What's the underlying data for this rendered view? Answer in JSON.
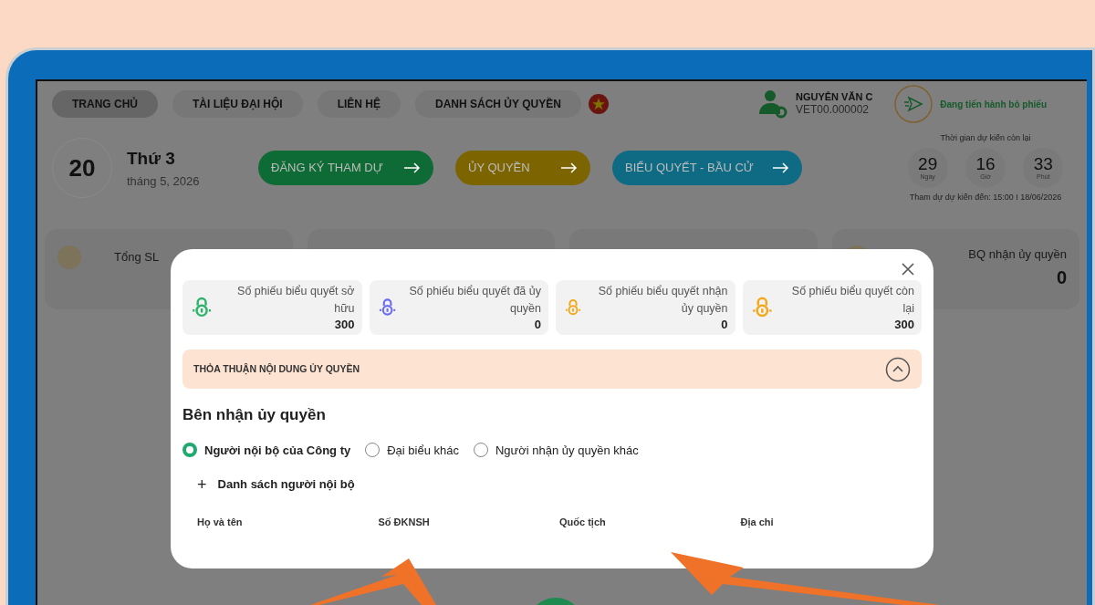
{
  "nav": {
    "items": [
      {
        "label": "TRANG CHỦ",
        "selected": true
      },
      {
        "label": "TÀI LIỆU ĐẠI HỘI",
        "selected": false
      },
      {
        "label": "LIÊN HỆ",
        "selected": false
      },
      {
        "label": "DANH SÁCH ỦY QUYỀN",
        "selected": false
      }
    ]
  },
  "user": {
    "name": "NGUYỄN VĂN C",
    "code": "VET00.000002"
  },
  "status": "Đang tiến hành bỏ phiếu",
  "date": {
    "day": "20",
    "weekday": "Thứ 3",
    "month_year": "tháng 5, 2026"
  },
  "actions": [
    {
      "label": "ĐĂNG KÝ THAM DỰ",
      "color": "#0f6b35"
    },
    {
      "label": "ỦY QUYỀN",
      "color": "#7c6400"
    },
    {
      "label": "BIỂU QUYẾT - BẦU CỬ",
      "color": "#0f6a84"
    }
  ],
  "countdown": {
    "title": "Thời gian dự kiến còn lại",
    "units": [
      {
        "value": "29",
        "label": "Ngày"
      },
      {
        "value": "16",
        "label": "Giờ"
      },
      {
        "value": "33",
        "label": "Phút"
      }
    ],
    "deadline": "Tham dự dự kiến đến: 15:00 I 18/06/2026"
  },
  "stat_cards": [
    {
      "label": "Tổng SL"
    },
    {
      "label": "BQ nhận ủy quyền",
      "value": "0"
    }
  ],
  "modal": {
    "vote_cards": [
      {
        "label": "Số phiếu biểu quyết sở hữu",
        "value": "300",
        "color": "#2fb36b"
      },
      {
        "label": "Số phiếu biểu quyết đã ủy quyền",
        "value": "0",
        "color": "#6b6bef"
      },
      {
        "label": "Số phiếu biểu quyết nhận ủy quyền",
        "value": "0",
        "color": "#f2a81d"
      },
      {
        "label": "Số phiếu biểu quyết còn lại",
        "value": "300",
        "color": "#f2a81d"
      }
    ],
    "section": {
      "title": "THỎA THUẬN NỘI DUNG ỦY QUYỀN",
      "expanded": true
    },
    "heading": "Bên nhận ủy quyền",
    "options": [
      {
        "label": "Người nội bộ của Công ty",
        "selected": true
      },
      {
        "label": "Đại biểu khác",
        "selected": false
      },
      {
        "label": "Người nhận ủy quyền khác",
        "selected": false
      }
    ],
    "add_link": {
      "icon": "+",
      "label": "Danh sách người nội bộ"
    },
    "table": {
      "columns": [
        "Họ và tên",
        "Số ĐKNSH",
        "Quốc tịch",
        "Địa chỉ"
      ]
    }
  }
}
